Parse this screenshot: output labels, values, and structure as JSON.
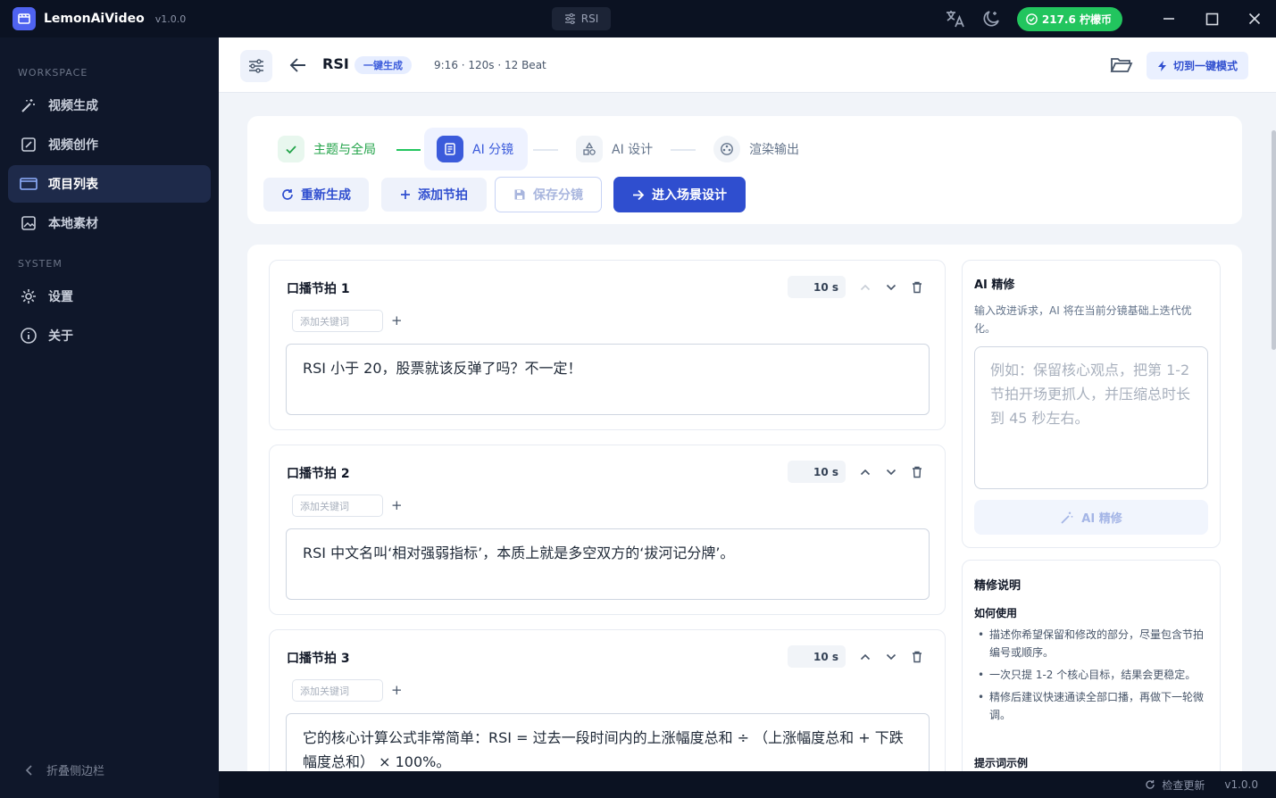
{
  "app": {
    "name": "LemonAiVideo",
    "version": "v1.0.0"
  },
  "titlebar": {
    "center_label": "RSI",
    "coins": "217.6 柠檬币"
  },
  "sidebar": {
    "workspace_label": "WORKSPACE",
    "system_label": "SYSTEM",
    "items": [
      {
        "label": "视频生成",
        "icon": "magic-wand-icon"
      },
      {
        "label": "视频创作",
        "icon": "edit-icon"
      },
      {
        "label": "项目列表",
        "icon": "folder-icon",
        "active": true
      },
      {
        "label": "本地素材",
        "icon": "image-icon"
      }
    ],
    "system_items": [
      {
        "label": "设置",
        "icon": "gear-icon"
      },
      {
        "label": "关于",
        "icon": "info-icon"
      }
    ],
    "collapse_label": "折叠侧边栏"
  },
  "header": {
    "title": "RSI",
    "mode_badge": "一键生成",
    "meta": "9:16 · 120s · 12 Beat",
    "switch_label": "切到一键模式"
  },
  "steps": [
    {
      "label": "主题与全局",
      "state": "done"
    },
    {
      "label": "AI 分镜",
      "state": "active"
    },
    {
      "label": "AI 设计",
      "state": "pending"
    },
    {
      "label": "渲染输出",
      "state": "pending"
    }
  ],
  "actions": {
    "regenerate": "重新生成",
    "add_beat": "添加节拍",
    "save": "保存分镜",
    "next": "进入场景设计"
  },
  "beats": [
    {
      "title": "口播节拍 1",
      "duration": "10 s",
      "keyword_placeholder": "添加关键词",
      "text": "RSI 小于 20，股票就该反弹了吗？不一定！"
    },
    {
      "title": "口播节拍 2",
      "duration": "10 s",
      "keyword_placeholder": "添加关键词",
      "text": "RSI 中文名叫‘相对强弱指标’，本质上就是多空双方的‘拔河记分牌’。"
    },
    {
      "title": "口播节拍 3",
      "duration": "10 s",
      "keyword_placeholder": "添加关键词",
      "text": "它的核心计算公式非常简单：RSI = 过去一段时间内的上涨幅度总和 ÷ （上涨幅度总和 + 下跌幅度总和） × 100%。"
    }
  ],
  "refine": {
    "title": "AI 精修",
    "desc": "输入改进诉求，AI 将在当前分镜基础上迭代优化。",
    "placeholder": "例如：保留核心观点，把第 1-2 节拍开场更抓人，并压缩总时长到 45 秒左右。",
    "button": "AI 精修"
  },
  "tips": {
    "title": "精修说明",
    "how_title": "如何使用",
    "items": [
      "描述你希望保留和修改的部分，尽量包含节拍编号或顺序。",
      "一次只提 1-2 个核心目标，结果会更稳定。",
      "精修后建议快速通读全部口播，再做下一轮微调。"
    ],
    "examples_title": "提示词示例"
  },
  "statusbar": {
    "update": "检查更新",
    "version": "v1.0.0"
  },
  "colors": {
    "accent": "#2f4ecf",
    "success": "#22c55e",
    "sidebar_bg": "#0f172a"
  }
}
